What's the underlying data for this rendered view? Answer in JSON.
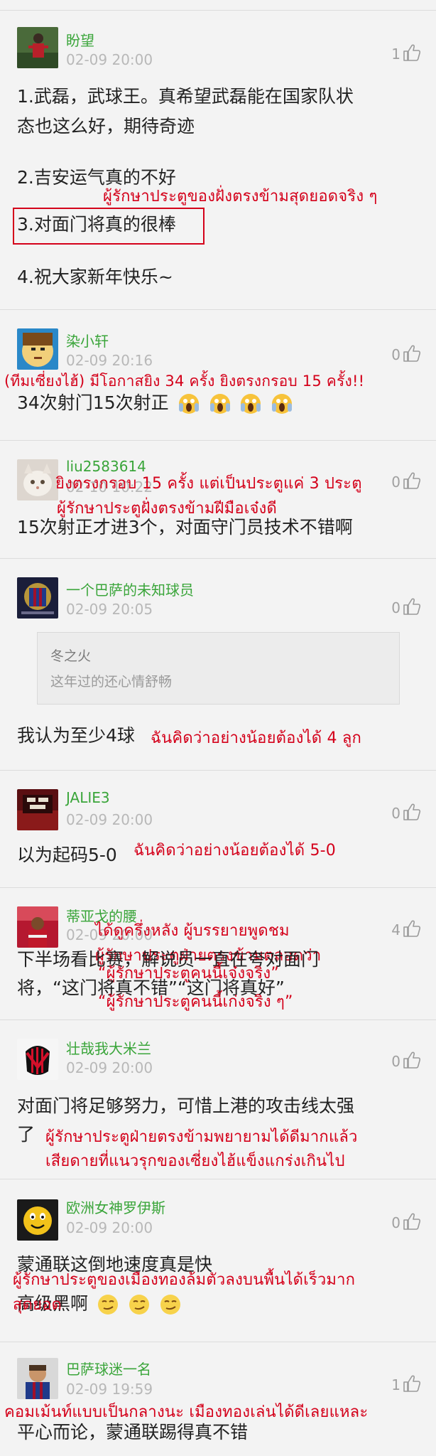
{
  "comments": [
    {
      "user": "盼望",
      "time": "02-09 20:00",
      "likes": "1",
      "lines": [
        "1.武磊，武球王。真希望武磊能在国家队状",
        "态也这么好，期待奇迹",
        "2.吉安运气真的不好",
        "3.对面门将真的很棒",
        "4.祝大家新年快乐~"
      ],
      "thai": [
        "ผู้รักษาประตูของฝั่งตรงข้ามสุดยอดจริง ๆ"
      ]
    },
    {
      "user": "染小轩",
      "time": "02-09 20:16",
      "likes": "0",
      "lines": [
        "34次射门15次射正"
      ],
      "thai": [
        "(ทีมเซี่ยงไฮ้) มีโอกาสยิง 34 ครั้ง ยิงตรงกรอบ 15 ครั้ง!!"
      ]
    },
    {
      "user": "liu2583614",
      "time": "02-10 10:22",
      "likes": "0",
      "lines": [
        "15次射正才进3个，对面守门员技术不错啊"
      ],
      "thai": [
        "ยิงตรงกรอบ 15 ครั้ง แต่เป็นประตูแค่ 3 ประตู",
        "ผู้รักษาประตูฝั่งตรงข้ามฝีมือเจ๋งดี"
      ]
    },
    {
      "user": "一个巴萨的未知球员",
      "time": "02-09 20:05",
      "likes": "0",
      "quote_user": "冬之火",
      "quote_text": "这年过的还心情舒畅",
      "lines": [
        "我认为至少4球"
      ],
      "thai": [
        "ฉันคิดว่าอย่างน้อยต้องได้ 4 ลูก"
      ]
    },
    {
      "user": "JALIE3",
      "time": "02-09 20:00",
      "likes": "0",
      "lines": [
        "以为起码5-0"
      ],
      "thai": [
        "ฉันคิดว่าอย่างน้อยต้องได้ 5-0"
      ]
    },
    {
      "user": "蒂亚戈的腰",
      "time": "02-09 20:00",
      "likes": "4",
      "lines": [
        "下半场看比赛，解说员一直在夸对面门",
        "将，“这门将真不错”“这门将真好”"
      ],
      "thai": [
        "ได้ดูครึ่งหลัง ผู้บรรยายพูดชม",
        "ผู้รักษาประตูฝ่ายตรงข้ามตลอดว่า",
        "“ผู้รักษาประตูคนนี้เจ๋งจริง”",
        "“ผู้รักษาประตูคนนี้เก่งจริง ๆ”"
      ]
    },
    {
      "user": "壮哉我大米兰",
      "time": "02-09 20:00",
      "likes": "0",
      "lines": [
        "对面门将足够努力，可惜上港的攻击线太强",
        "了"
      ],
      "thai": [
        "ผู้รักษาประตูฝ่ายตรงข้ามพยายามได้ดีมากแล้ว",
        "เสียดายที่แนวรุกของเซี่ยงไฮ้แข็งแกร่งเกินไป"
      ]
    },
    {
      "user": "欧洲女神罗伊斯",
      "time": "02-09 20:00",
      "likes": "0",
      "lines": [
        "蒙通联这倒地速度真是快",
        "高级黑啊"
      ],
      "thai": [
        "ผู้รักษาประตูของเมืองทองล้มตัวลงบนพื้นได้เร็วมาก",
        "สุดยอด"
      ]
    },
    {
      "user": "巴萨球迷一名",
      "time": "02-09 19:59",
      "likes": "1",
      "lines": [
        "平心而论，蒙通联踢得真不错"
      ],
      "thai": [
        "คอมเม้นท์แบบเป็นกลางนะ เมืองทองเล่นได้ดีเลยแหละ"
      ]
    }
  ]
}
